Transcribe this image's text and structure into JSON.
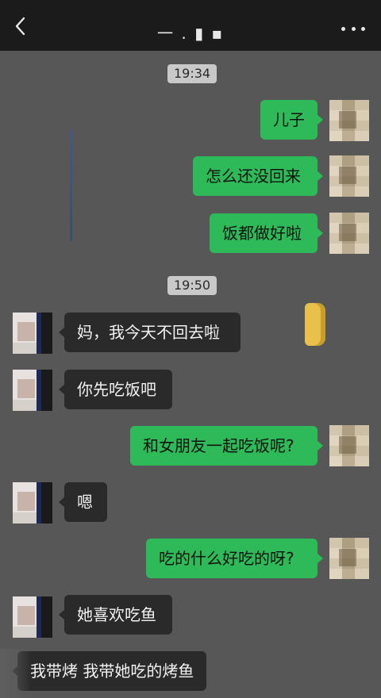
{
  "header": {
    "title": "一 . ▮ ▪",
    "back_icon": "chevron-left-icon",
    "more_icon": "more-dots-icon"
  },
  "chat": {
    "timestamps": [
      "19:34",
      "19:50"
    ],
    "messages": [
      {
        "side": "out",
        "text": "儿子"
      },
      {
        "side": "out",
        "text": "怎么还没回来"
      },
      {
        "side": "out",
        "text": "饭都做好啦"
      },
      {
        "side": "in",
        "text": "妈，我今天不回去啦"
      },
      {
        "side": "in",
        "text": "你先吃饭吧"
      },
      {
        "side": "out",
        "text": "和女朋友一起吃饭呢?"
      },
      {
        "side": "in",
        "text": "嗯"
      },
      {
        "side": "out",
        "text": "吃的什么好吃的呀?"
      },
      {
        "side": "in",
        "text": "她喜欢吃鱼"
      },
      {
        "side": "in",
        "text": "我带烤 我带她吃的烤鱼"
      }
    ]
  },
  "colors": {
    "background": "#575757",
    "header": "#1b1b1b",
    "outgoing_bubble": "#2fba59",
    "incoming_bubble": "#2a2a2a",
    "timestamp_bg": "#c9c9c9"
  }
}
